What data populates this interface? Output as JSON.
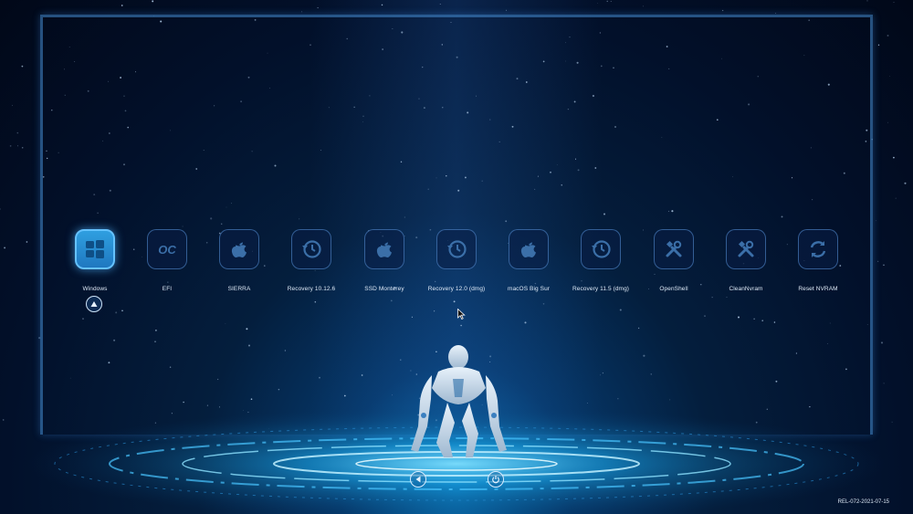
{
  "boot_entries": [
    {
      "label": "Windows",
      "icon": "windows-icon",
      "selected": true
    },
    {
      "label": "EFI",
      "icon": "opencore-icon",
      "selected": false
    },
    {
      "label": "SIERRA",
      "icon": "apple-icon",
      "selected": false
    },
    {
      "label": "Recovery 10.12.6",
      "icon": "recovery-icon",
      "selected": false
    },
    {
      "label": "SSD Monterey",
      "icon": "apple-icon",
      "selected": false
    },
    {
      "label": "Recovery 12.0 (dmg)",
      "icon": "recovery-icon",
      "selected": false
    },
    {
      "label": "macOS Big Sur",
      "icon": "apple-icon",
      "selected": false
    },
    {
      "label": "Recovery 11.5 (dmg)",
      "icon": "recovery-icon",
      "selected": false
    },
    {
      "label": "OpenShell",
      "icon": "tools-icon",
      "selected": false
    },
    {
      "label": "CleanNvram",
      "icon": "tools-icon",
      "selected": false
    },
    {
      "label": "Reset NVRAM",
      "icon": "reset-icon",
      "selected": false
    }
  ],
  "opencore_mark": "OC",
  "controls": {
    "restart_icon": "restart-icon",
    "shutdown_icon": "power-icon"
  },
  "version": "REL-072-2021-07-15",
  "colors": {
    "accent": "#2f9fe0",
    "tile_border": "#5a96dc",
    "background": "#02102a"
  }
}
